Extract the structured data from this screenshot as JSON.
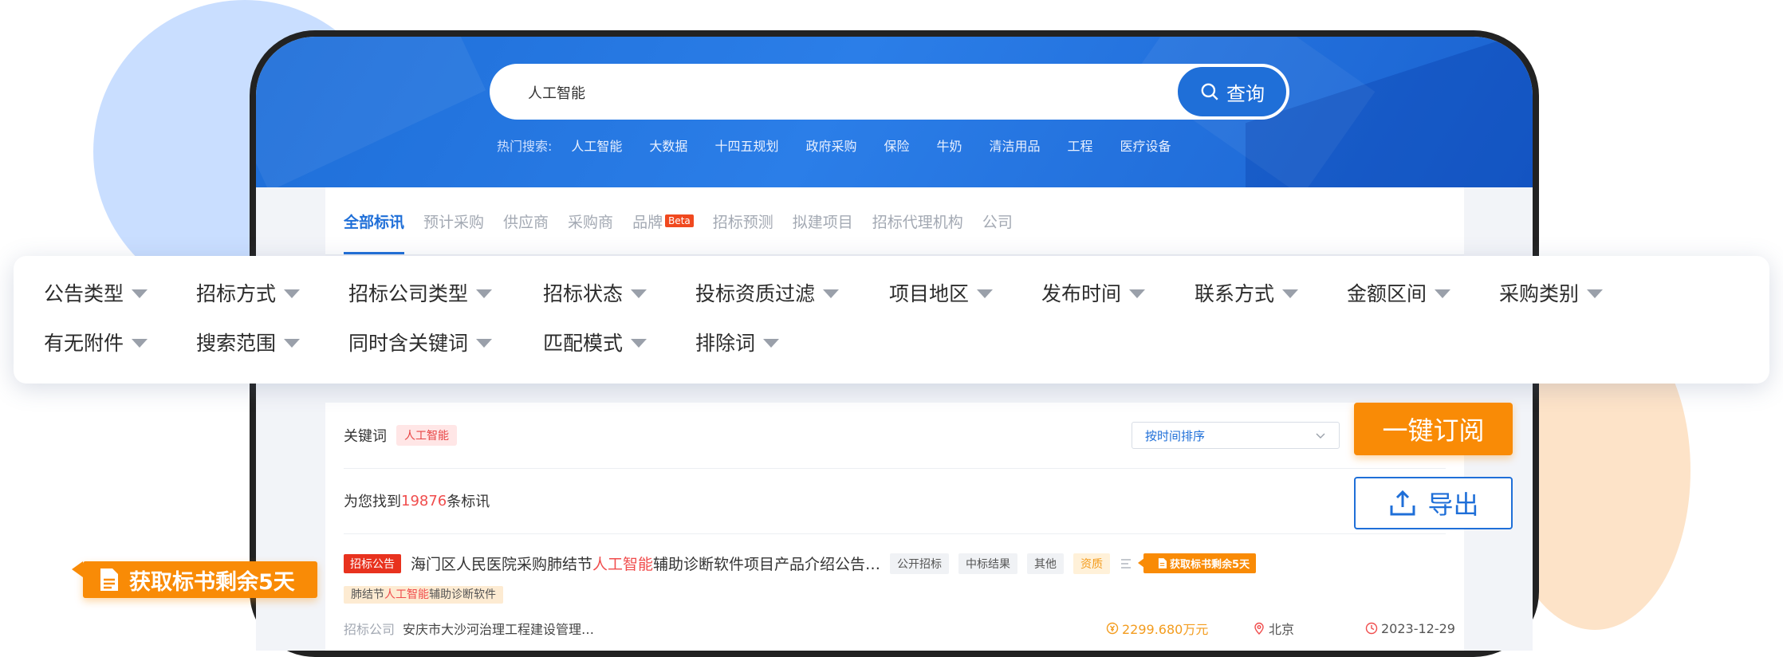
{
  "search": {
    "value": "人工智能",
    "button_label": "查询"
  },
  "hot_search": {
    "label": "热门搜索:",
    "items": [
      "人工智能",
      "大数据",
      "十四五规划",
      "政府采购",
      "保险",
      "牛奶",
      "清洁用品",
      "工程",
      "医疗设备"
    ]
  },
  "tabs": [
    {
      "label": "全部标讯"
    },
    {
      "label": "预计采购"
    },
    {
      "label": "供应商"
    },
    {
      "label": "采购商"
    },
    {
      "label": "品牌"
    },
    {
      "label": "招标预测"
    },
    {
      "label": "拟建项目"
    },
    {
      "label": "招标代理机构"
    },
    {
      "label": "公司"
    }
  ],
  "beta_badge": "Beta",
  "filters": {
    "row1": [
      "公告类型",
      "招标方式",
      "招标公司类型",
      "招标状态",
      "投标资质过滤",
      "项目地区",
      "发布时间",
      "联系方式",
      "金额区间",
      "采购类别"
    ],
    "row2": [
      "有无附件",
      "搜索范围",
      "同时含关键词",
      "匹配模式",
      "排除词"
    ]
  },
  "keyword": {
    "label": "关键词",
    "tag": "人工智能"
  },
  "sort": {
    "value": "按时间排序"
  },
  "results": {
    "prefix": "为您找到",
    "count": "19876",
    "suffix": "条标讯"
  },
  "actions": {
    "subscribe": "一键订阅",
    "export": "导出"
  },
  "item": {
    "type_badge": "招标公告",
    "title_pre": "海门区人民医院采购肺结节",
    "title_hl": "人工智能",
    "title_post": "辅助诊断软件项目产品介绍公告…",
    "chips": [
      "公开招标",
      "中标结果",
      "其他"
    ],
    "chip_orange": "资质",
    "doc_badge": "获取标书剩余5天",
    "sub_tag_pre": "肺结节",
    "sub_tag_hl": "人工智能",
    "sub_tag_post": "辅助诊断软件",
    "company_label": "招标公司",
    "company_name": "安庆市大沙河治理工程建设管理…",
    "amount": "2299.680万元",
    "location": "北京",
    "date": "2023-12-29"
  },
  "ribbon": {
    "label": "获取标书剩余5天"
  },
  "colors": {
    "primary": "#1f6fd8",
    "orange": "#f98b06",
    "red": "#e8321e",
    "highlight": "#f04d4d"
  }
}
